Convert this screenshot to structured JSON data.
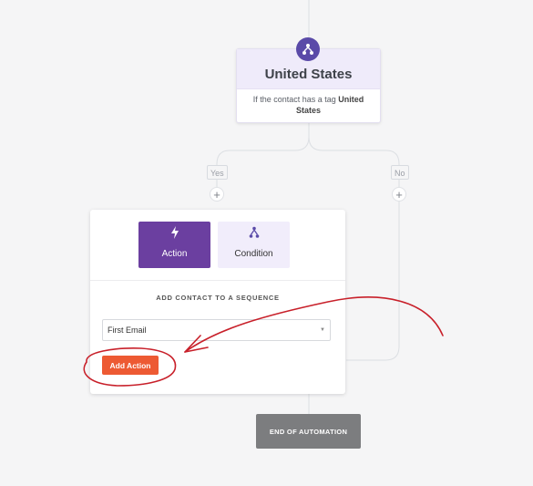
{
  "condition_node": {
    "title": "United States",
    "description_prefix": "If the contact has a tag",
    "tag": "United States"
  },
  "branches": {
    "yes_label": "Yes",
    "no_label": "No"
  },
  "panel": {
    "tabs": [
      {
        "label": "Action",
        "icon": "bolt-icon",
        "active": true
      },
      {
        "label": "Condition",
        "icon": "branch-icon",
        "active": false
      }
    ],
    "section_title": "ADD CONTACT TO A SEQUENCE",
    "sequence_select": {
      "value": "First Email"
    },
    "add_action_label": "Add Action"
  },
  "end_node": {
    "label": "END OF AUTOMATION"
  },
  "plus_symbol": "+",
  "colors": {
    "action_tab": "#6b3fa0",
    "condition_tab": "#f1edfb",
    "add_action_button": "#ed5a33",
    "node_icon": "#5a4aa8",
    "end_node": "#7c7d7f",
    "annotation": "#c8202a"
  }
}
